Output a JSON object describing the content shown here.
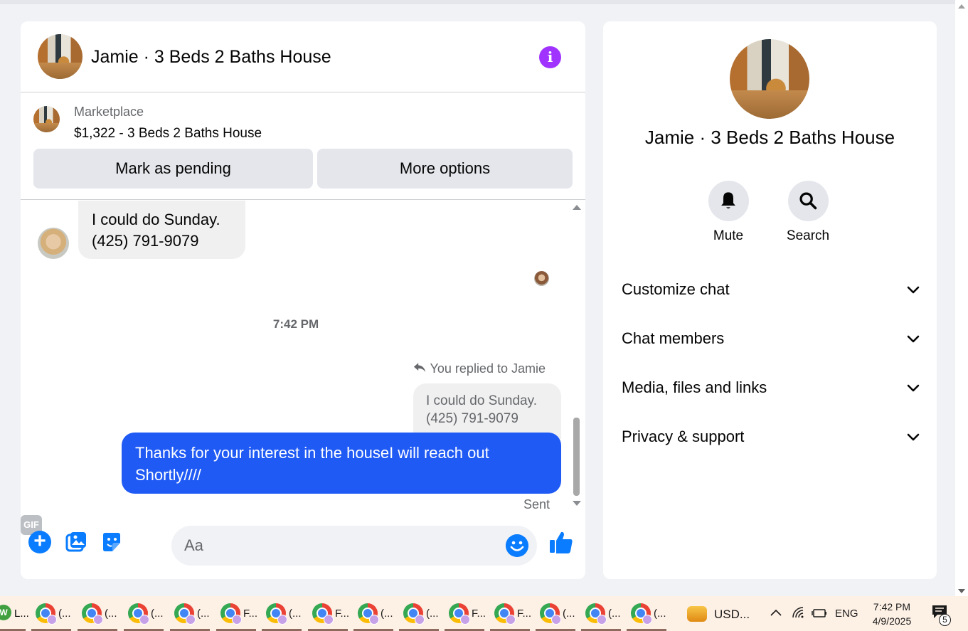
{
  "chat": {
    "title": "Jamie · 3 Beds 2 Baths House",
    "marketplace": {
      "label": "Marketplace",
      "listing": "$1,322 - 3 Beds 2 Baths House",
      "mark_pending_label": "Mark as pending",
      "more_options_label": "More options"
    },
    "messages": {
      "incoming_line1": "I could do Sunday.",
      "incoming_line2": "(425) 791-9079",
      "timestamp": "7:42 PM",
      "reply_note": "You replied to Jamie",
      "quoted_line1": "I could do Sunday.",
      "quoted_line2": "(425) 791-9079",
      "outgoing": "Thanks for your interest in the houseI will reach out Shortly////",
      "status": "Sent"
    },
    "composer": {
      "placeholder": "Aa",
      "gif_label": "GIF"
    }
  },
  "info_panel": {
    "title": "Jamie · 3 Beds 2 Baths House",
    "actions": [
      {
        "label": "Mute",
        "icon": "bell-icon"
      },
      {
        "label": "Search",
        "icon": "search-icon"
      }
    ],
    "sections": [
      {
        "label": "Customize chat"
      },
      {
        "label": "Chat members"
      },
      {
        "label": "Media, files and links"
      },
      {
        "label": "Privacy & support"
      }
    ]
  },
  "taskbar": {
    "items": [
      {
        "label": "L..."
      },
      {
        "label": "(..."
      },
      {
        "label": "(..."
      },
      {
        "label": "(..."
      },
      {
        "label": "(..."
      },
      {
        "label": "F..."
      },
      {
        "label": "(..."
      },
      {
        "label": "F..."
      },
      {
        "label": "(..."
      },
      {
        "label": "(..."
      },
      {
        "label": "F..."
      },
      {
        "label": "F..."
      },
      {
        "label": "(..."
      },
      {
        "label": "(..."
      },
      {
        "label": "(..."
      }
    ],
    "widget_label": "USD...",
    "language": "ENG",
    "time": "7:42 PM",
    "date": "4/9/2025",
    "notification_count": "5"
  },
  "colors": {
    "accent_blue": "#1f5af5",
    "messenger_blue": "#0a7cff",
    "info_purple": "#a033ff"
  }
}
